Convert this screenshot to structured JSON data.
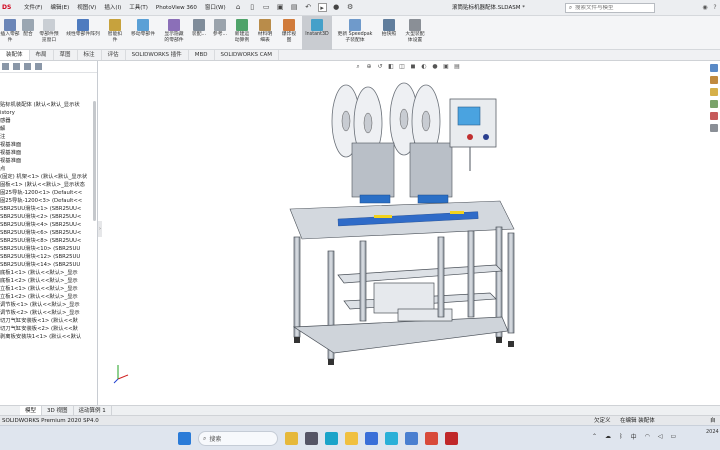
{
  "app": {
    "logo": "DS",
    "doc_title": "滚筒贴标机器配体.SLDASM *"
  },
  "menus": [
    "文件(F)",
    "编辑(E)",
    "视图(V)",
    "插入(I)",
    "工具(T)",
    "PhotoView 360",
    "窗口(W)"
  ],
  "quick_access": [
    "home-icon",
    "new-icon",
    "open-icon",
    "save-icon",
    "print-icon",
    "undo-icon",
    "select-icon",
    "rebuild-icon",
    "options-icon"
  ],
  "search": {
    "placeholder": "搜索文件与模型"
  },
  "ribbon": [
    {
      "label": "插入零部件",
      "color": "#6b86b8"
    },
    {
      "label": "配合",
      "color": "#9aa6b2"
    },
    {
      "label": "零部件预\n览窗口",
      "color": "#c9ced4"
    },
    {
      "label": "线性零部件阵列",
      "color": "#4e7bbf"
    },
    {
      "label": "智能扣\n件",
      "color": "#c7a23d"
    },
    {
      "label": "移动零部件",
      "color": "#5aa0d6"
    },
    {
      "label": "显示隐藏\n的零部件",
      "color": "#8b6fb8"
    },
    {
      "label": "装配...",
      "color": "#7f8c9a"
    },
    {
      "label": "参考...",
      "color": "#9aa3ac"
    },
    {
      "label": "新建运\n动算例",
      "color": "#4fa36a"
    },
    {
      "label": "材料明\n细表",
      "color": "#b98c4a"
    },
    {
      "label": "爆炸视\n图",
      "color": "#d07b3b"
    },
    {
      "label": "Instant3D",
      "color": "#45a0c9",
      "active": true
    },
    {
      "label": "更新 Speedpak\n子装配体",
      "color": "#6f9acb"
    },
    {
      "label": "拍快照",
      "color": "#607d9c"
    },
    {
      "label": "大型装配\n体设置",
      "color": "#8a8f96"
    }
  ],
  "tabs": [
    "装配体",
    "布局",
    "草图",
    "标注",
    "评估",
    "SOLIDWORKS 插件",
    "MBD",
    "SOLIDWORKS CAM"
  ],
  "tree_items": [
    "贴标机装配体 (默认<默认_显示状",
    "istory",
    "感器",
    "解",
    "注",
    "视基准面",
    "视基准面",
    "视基准面",
    "点",
    "(固定) 机架<1> (默认<默认_显示状",
    "固板<1> (默认<<默认>_显示状态",
    "固25导轨-1200<1> (Default<<",
    "固25导轨-1200<3> (Default<<",
    "SBR25UU滑块<1> (SBR25UU<",
    "SBR25UU滑块<2> (SBR25UU<",
    "SBR25UU滑块<4> (SBR25UU<",
    "SBR25UU滑块<6> (SBR25UU<",
    "SBR25UU滑块<8> (SBR25UU<",
    "SBR25UU滑块<10> (SBR25UU",
    "SBR25UU滑块<12> (SBR25UU",
    "SBR25UU滑块<14> (SBR25UU",
    "底板1<1> (默认<<默认>_显示",
    "底板1<2> (默认<<默认>_显示",
    "立板1<1> (默认<<默认>_显示",
    "立板1<2> (默认<<默认>_显示",
    "调节板<1> (默认<<默认>_显示",
    "调节板<2> (默认<<默认>_显示",
    "切刀气缸安装板<1> (默认<<默",
    "切刀气缸安装板<2> (默认<<默",
    "剥离板安装块1<1> (默认<<默认"
  ],
  "bottom_tabs": [
    "模型",
    "3D 视图",
    "运动算例 1"
  ],
  "status": {
    "left": "SOLIDWORKS Premium 2020 SP4.0",
    "s1": "欠定义",
    "s2": "在编辑 装配体",
    "s3": "自定"
  },
  "taskbar": {
    "search_label": "搜索",
    "clock": "2024"
  }
}
